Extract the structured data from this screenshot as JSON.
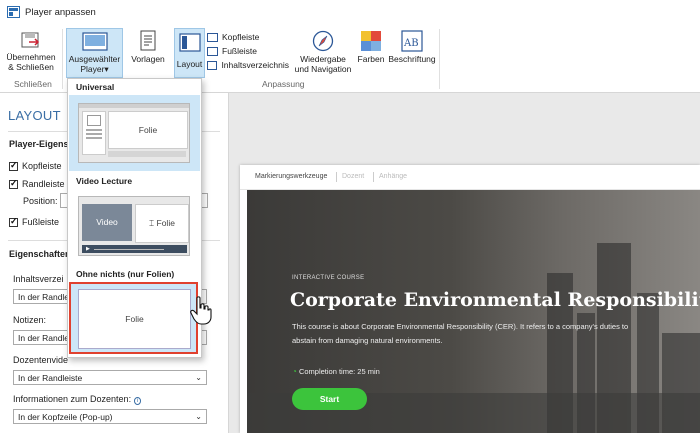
{
  "window": {
    "title": "Player anpassen"
  },
  "ribbon": {
    "apply_label_1": "Übernehmen",
    "apply_label_2": "& Schließen",
    "selected_player_1": "Ausgewählter",
    "selected_player_2": "Player",
    "templates": "Vorlagen",
    "layout": "Layout",
    "header": "Kopfleiste",
    "footer": "Fußleiste",
    "toc": "Inhaltsverzeichnis",
    "playback_1": "Wiedergabe",
    "playback_2": "und Navigation",
    "colors": "Farben",
    "caption": "Beschriftung",
    "group_close": "Schließen",
    "group_customize": "Anpassung"
  },
  "left": {
    "heading": "LAYOUT",
    "player_props": "Player-Eigens",
    "cb_header": "Kopfleiste",
    "cb_sidebar": "Randleiste",
    "position": "Position:",
    "cb_footer": "Fußleiste",
    "properties": "Eigenschaften",
    "toc_label": "Inhaltsverzei",
    "toc_value": "In der Randle",
    "notes_label": "Notizen:",
    "notes_value": "In der Randle",
    "presenter_video_label": "Dozentenvide",
    "presenter_video_value": "In der Randleiste",
    "presenter_info_label": "Informationen zum Dozenten:",
    "presenter_info_value": "In der Kopfzeile (Pop-up)"
  },
  "dropdown": {
    "universal": "Universal",
    "universal_slide": "Folie",
    "video_lecture": "Video Lecture",
    "video": "Video",
    "video_slide": "Folie",
    "none": "Ohne nichts (nur Folien)",
    "none_slide": "Folie"
  },
  "preview": {
    "tabs": [
      "Markierungswerkzeuge",
      "Dozent",
      "Anhänge"
    ],
    "kicker": "INTERACTIVE COURSE",
    "title": "Corporate Environmental Responsibility",
    "desc_1": "This course is about Corporate Environmental Responsibility (CER). It refers to a company's duties to",
    "desc_2": "abstain from damaging natural environments.",
    "completion": "Completion time: 25 min",
    "start": "Start"
  },
  "colors": {
    "accent": "#3a6ea5",
    "selected": "#cde6f7",
    "start": "#3cc43c",
    "highlight": "#e0412f"
  }
}
